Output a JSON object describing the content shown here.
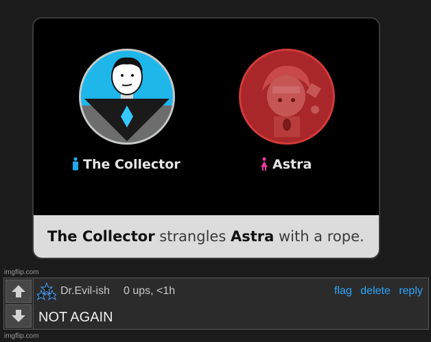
{
  "meme": {
    "left_character": {
      "name": "The Collector",
      "icon": "male-person-icon",
      "icon_color": "#1fa9ea"
    },
    "right_character": {
      "name": "Astra",
      "icon": "female-person-icon",
      "icon_color": "#e83a9c"
    },
    "caption": {
      "actor": "The Collector",
      "verb": " strangles ",
      "target": "Astra",
      "rest": " with a rope."
    }
  },
  "watermarks": {
    "top": "imgflip.com",
    "bottom": "imgflip.com"
  },
  "comment": {
    "username": "Dr.Evil-ish",
    "meta": "0 ups, <1h",
    "actions": {
      "flag": "flag",
      "delete": "delete",
      "reply": "reply"
    },
    "text": "NOT AGAIN",
    "icons": {
      "upvote": "up-arrow-icon",
      "downvote": "down-arrow-icon",
      "user": "stars-badge-icon"
    }
  },
  "colors": {
    "link": "#2aa7ff",
    "caption_bg": "#dcdcdc"
  }
}
